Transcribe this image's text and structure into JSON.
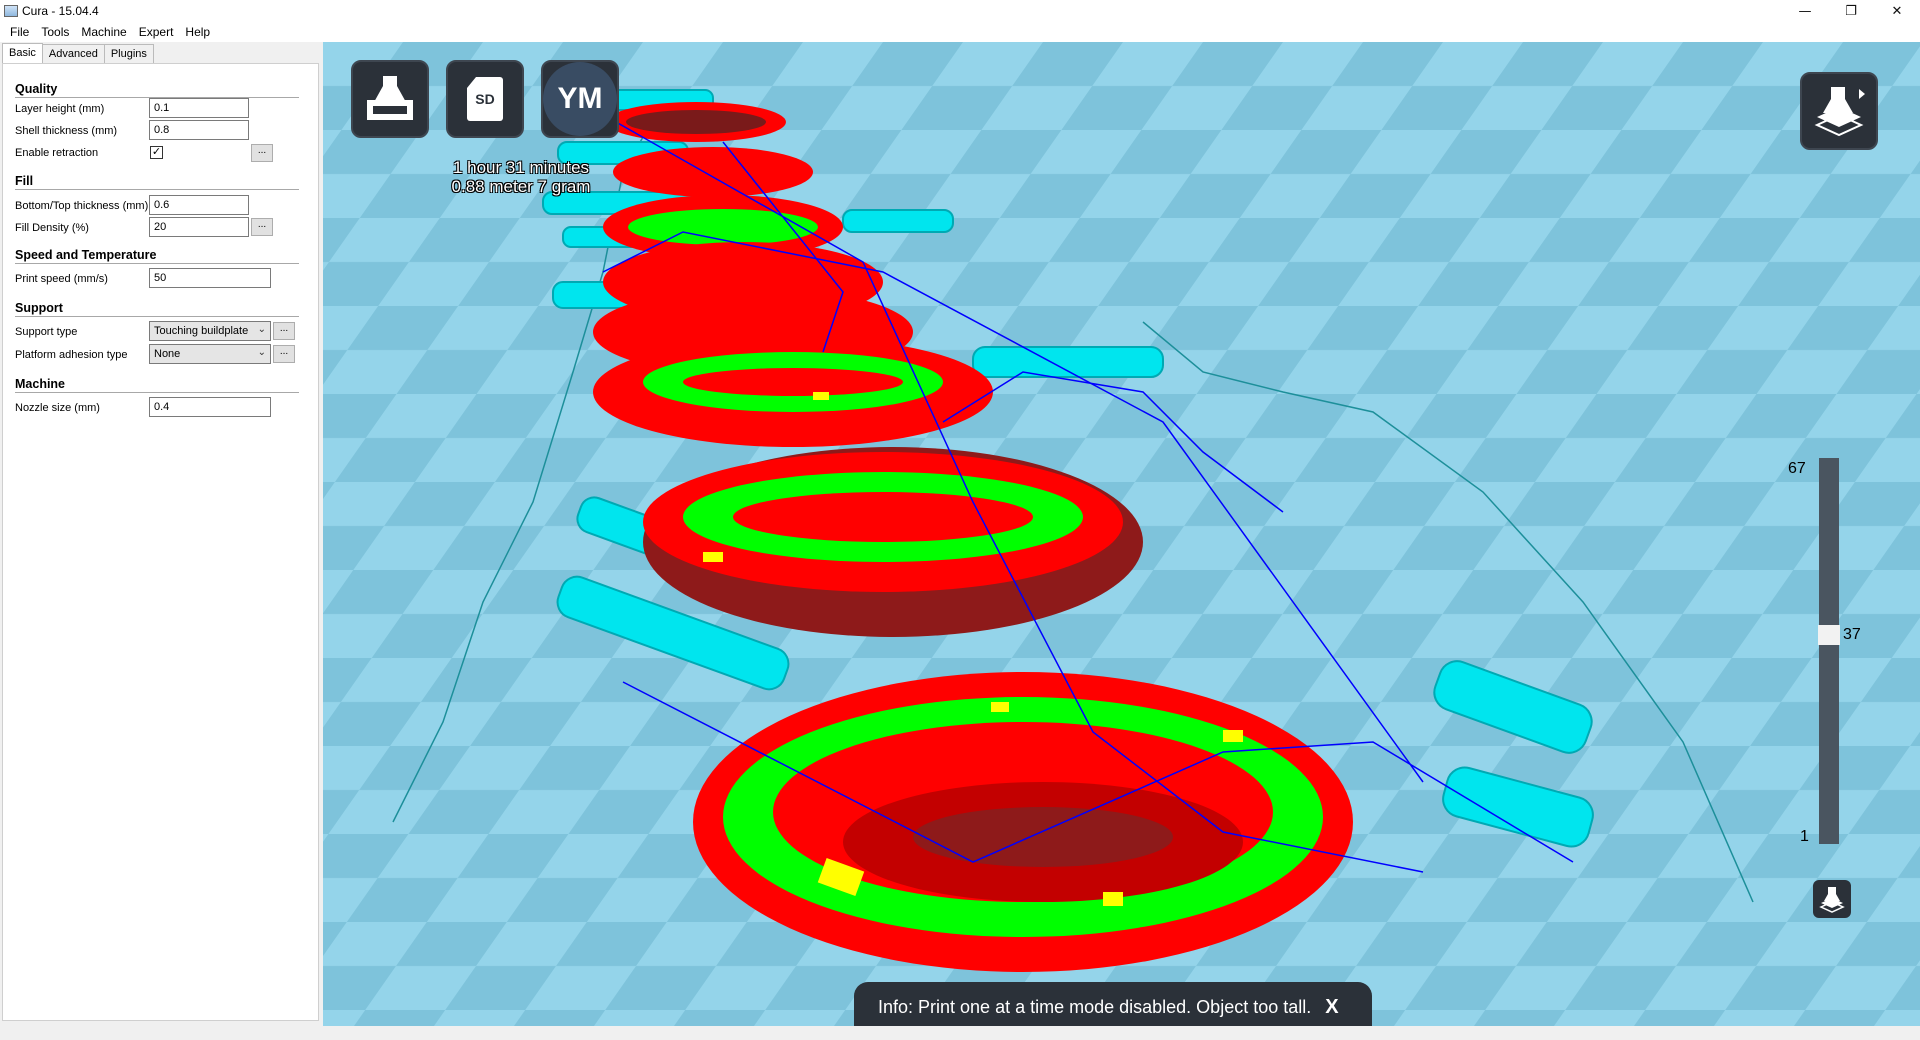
{
  "window": {
    "title": "Cura - 15.04.4",
    "minimize": "—",
    "maximize": "❐",
    "close": "✕"
  },
  "menu": [
    "File",
    "Tools",
    "Machine",
    "Expert",
    "Help"
  ],
  "tabs": [
    "Basic",
    "Advanced",
    "Plugins"
  ],
  "sections": {
    "quality": {
      "title": "Quality",
      "layer_height_label": "Layer height (mm)",
      "layer_height": "0.1",
      "shell_thickness_label": "Shell thickness (mm)",
      "shell_thickness": "0.8",
      "retraction_label": "Enable retraction",
      "retraction_checked": "✓"
    },
    "fill": {
      "title": "Fill",
      "bottom_top_label": "Bottom/Top thickness (mm)",
      "bottom_top": "0.6",
      "density_label": "Fill Density (%)",
      "density": "20"
    },
    "speed": {
      "title": "Speed and Temperature",
      "print_speed_label": "Print speed (mm/s)",
      "print_speed": "50"
    },
    "support": {
      "title": "Support",
      "support_type_label": "Support type",
      "support_type": "Touching buildplate",
      "adhesion_label": "Platform adhesion type",
      "adhesion": "None"
    },
    "machine": {
      "title": "Machine",
      "nozzle_label": "Nozzle size (mm)",
      "nozzle": "0.4"
    }
  },
  "dots_label": "...",
  "viewport": {
    "sd_label": "SD",
    "ym_label": "YM",
    "print_time": "1 hour 31 minutes",
    "print_material": "0.88 meter 7 gram",
    "layer_max": "67",
    "layer_current": "37",
    "layer_min": "1",
    "layer_fraction": 0.545,
    "info_text": "Info: Print one at a time mode disabled. Object too tall.",
    "info_close": "X"
  },
  "colors": {
    "floor_light": "#8fd0e6",
    "floor_dark": "#6fb4cf",
    "outer_wall": "#ff0000",
    "inner_wall": "#00ff00",
    "top_bottom": "#ffff00",
    "support": "#00e5ee",
    "travel": "#0000ff"
  }
}
